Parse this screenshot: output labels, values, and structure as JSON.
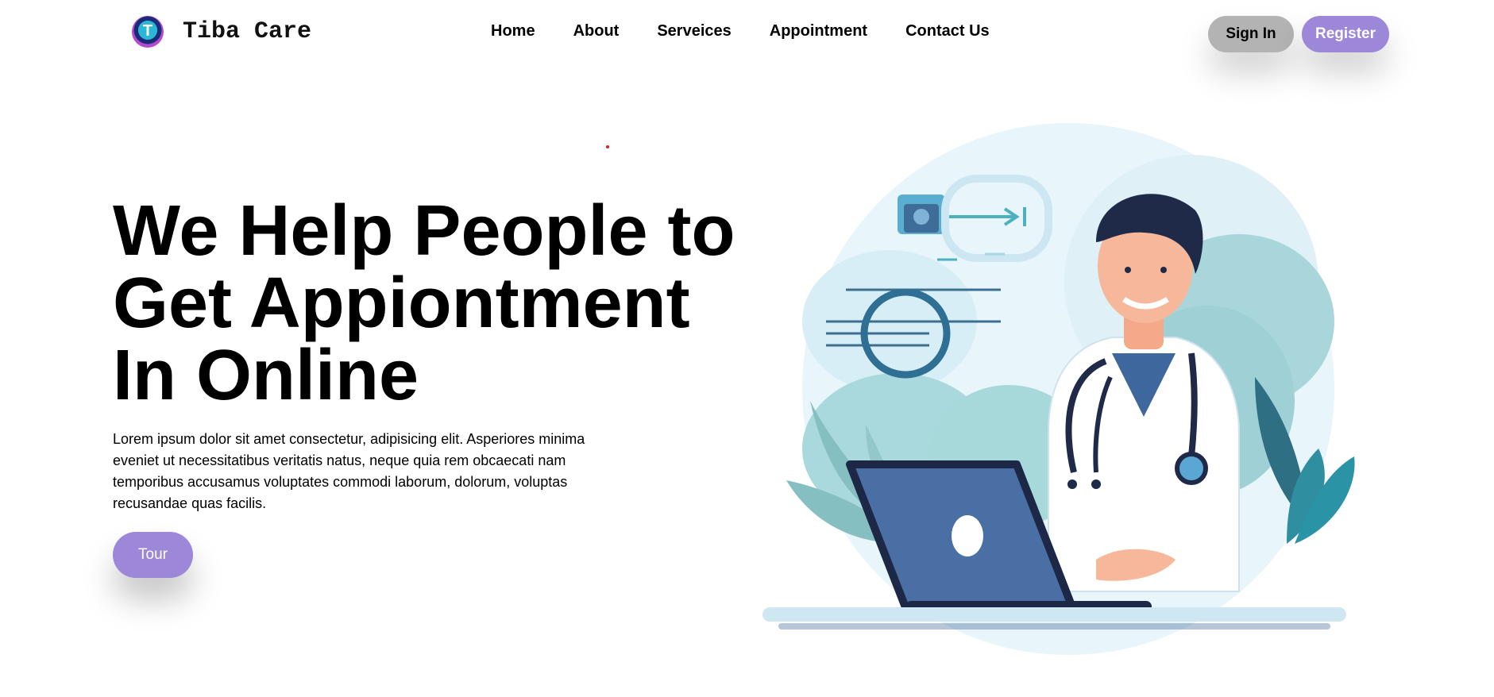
{
  "brand": {
    "logo_letter": "T",
    "name": "Tiba Care"
  },
  "nav": {
    "items": [
      "Home",
      "About",
      "Serveices",
      "Appointment",
      "Contact Us"
    ]
  },
  "auth": {
    "signin_label": "Sign In",
    "register_label": "Register"
  },
  "hero": {
    "headline_lines": [
      "We Help People to",
      "Get Appiontment",
      "In Online"
    ],
    "body": "Lorem ipsum dolor sit amet consectetur, adipisicing elit. Asperiores minima eveniet ut necessitatibus veritatis natus, neque quia rem obcaecati nam temporibus accusamus voluptates commodi laborum, dolorum, voluptas recusandae quas facilis.",
    "tour_label": "Tour"
  },
  "colors": {
    "accent": "#9c87d9",
    "signin_bg": "#b3b3b3",
    "text": "#000000",
    "background": "#ffffff"
  },
  "icons": {
    "logo": "tiba-care-logo-icon"
  }
}
